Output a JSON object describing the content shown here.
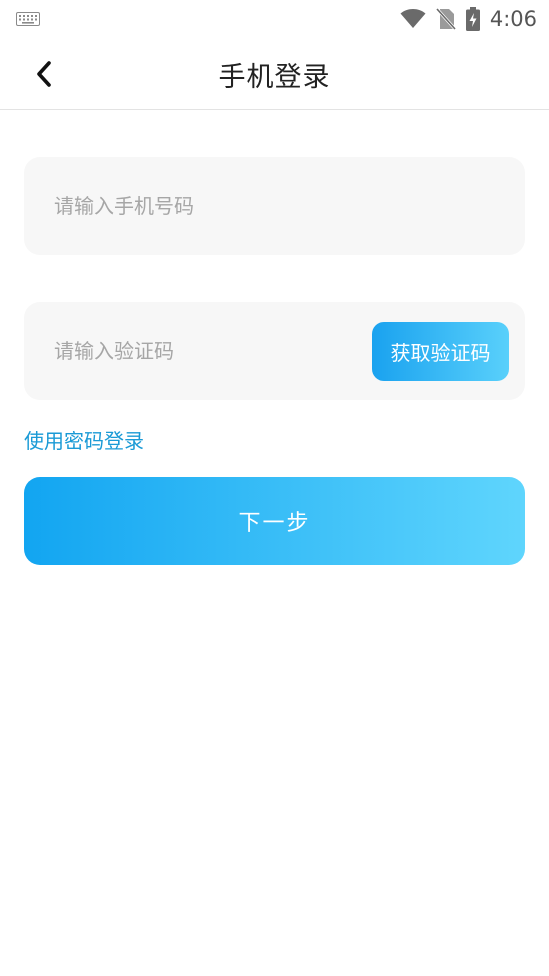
{
  "status_bar": {
    "time": "4:06",
    "icons": [
      "keyboard-icon",
      "wifi-icon",
      "no-sim-icon",
      "battery-charging-icon"
    ]
  },
  "header": {
    "title": "手机登录",
    "back_icon": "chevron-left-icon"
  },
  "form": {
    "phone": {
      "value": "",
      "placeholder": "请输入手机号码"
    },
    "code": {
      "value": "",
      "placeholder": "请输入验证码"
    },
    "get_code_label": "获取验证码",
    "password_login_label": "使用密码登录",
    "next_label": "下一步"
  },
  "colors": {
    "accent_start": "#12a5f1",
    "accent_end": "#5fd5fd",
    "link": "#1a9ad6",
    "field_bg": "#f7f7f7"
  }
}
